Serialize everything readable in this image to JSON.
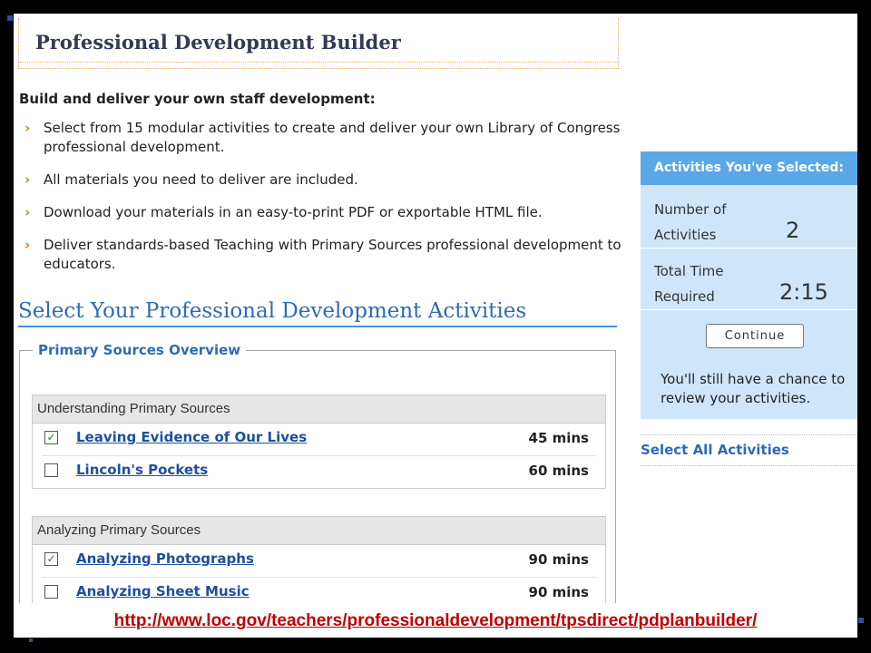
{
  "page": {
    "title": "Professional Development Builder",
    "intro_heading": "Build and deliver your own staff development:",
    "bullets": [
      "Select from 15 modular activities to create and deliver your own Library of Congress professional development.",
      "All materials you need to deliver are included.",
      "Download your materials in an easy-to-print PDF or exportable HTML file.",
      "Deliver standards-based Teaching with Primary Sources professional development to educators."
    ],
    "select_title": "Select Your Professional Development Activities"
  },
  "overview": {
    "legend": "Primary Sources Overview",
    "groups": [
      {
        "header": "Understanding Primary Sources",
        "activities": [
          {
            "name": "Leaving Evidence of Our Lives",
            "duration": "45 mins",
            "checked": true
          },
          {
            "name": "Lincoln's Pockets",
            "duration": "60 mins",
            "checked": false
          }
        ]
      },
      {
        "header": "Analyzing Primary Sources",
        "activities": [
          {
            "name": "Analyzing Photographs",
            "duration": "90 mins",
            "checked": true
          },
          {
            "name": "Analyzing Sheet Music",
            "duration": "90 mins",
            "checked": false
          }
        ]
      }
    ]
  },
  "sidebar": {
    "header": "Activities You've Selected:",
    "count_label_1": "Number of",
    "count_label_2": "Activities",
    "count_value": "2",
    "time_label_1": "Total Time",
    "time_label_2": "Required",
    "time_value": "2:15",
    "continue_label": "Continue",
    "note": "You'll still have a chance to review your activities.",
    "select_all": "Select All Activities"
  },
  "footer": {
    "url": "http://www.loc.gov/teachers/professionaldevelopment/tpsdirect/pdplanbuilder/"
  },
  "icons": {
    "bullet": "arrow-right-icon",
    "checkbox_checked": "checkmark-icon"
  },
  "colors": {
    "accent_blue": "#2f6ab5",
    "sidebar_header": "#5aa7e8",
    "sidebar_bg": "#cfe6fa",
    "bullet_orange": "#e07b22",
    "url_red": "#c00000"
  }
}
